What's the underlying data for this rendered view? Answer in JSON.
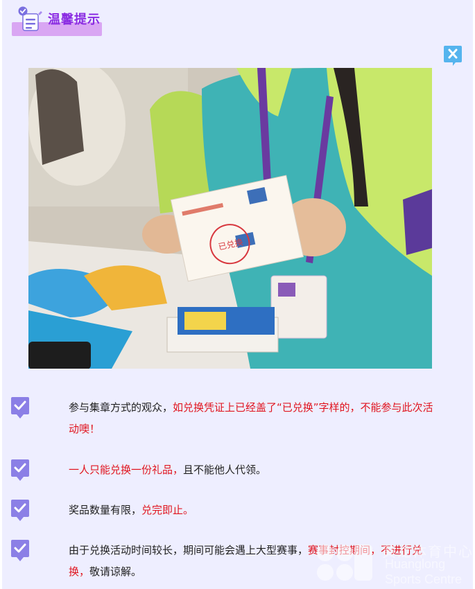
{
  "header": {
    "title": "温馨提示",
    "icon": "clipboard-check-icon"
  },
  "close_icon": "close-icon",
  "photo": {
    "stamp_text": "已兑换"
  },
  "tips": [
    {
      "icon": "check-badge-icon",
      "parts": [
        {
          "text": "参与集章方式的观众，",
          "red": false
        },
        {
          "text": "如兑换凭证上已经盖了“已兑换”字样的，不能参与此次活动噢！",
          "red": true
        }
      ]
    },
    {
      "icon": "check-badge-icon",
      "parts": [
        {
          "text": "一人只能兑换一份礼品，",
          "red": true
        },
        {
          "text": "且不能他人代领。",
          "red": false
        }
      ]
    },
    {
      "icon": "check-badge-icon",
      "parts": [
        {
          "text": "奖品数量有限，",
          "red": false
        },
        {
          "text": "兑完即止。",
          "red": true
        }
      ]
    },
    {
      "icon": "check-badge-icon",
      "parts": [
        {
          "text": "由于兑换活动时间较长，期间可能会遇上大型赛事，",
          "red": false
        },
        {
          "text": "赛事封控期间，不进行兑换，",
          "red": true
        },
        {
          "text": "敬请谅解。",
          "red": false
        }
      ]
    }
  ],
  "watermark": {
    "cn": "黄龙体育中心",
    "en1": "Huanglong",
    "en2": "Sports Centre"
  },
  "colors": {
    "background": "#eeeeff",
    "accent_purple": "#8a2be2",
    "highlight_red": "#e0141e",
    "check_icon": "#8b7fe6"
  }
}
